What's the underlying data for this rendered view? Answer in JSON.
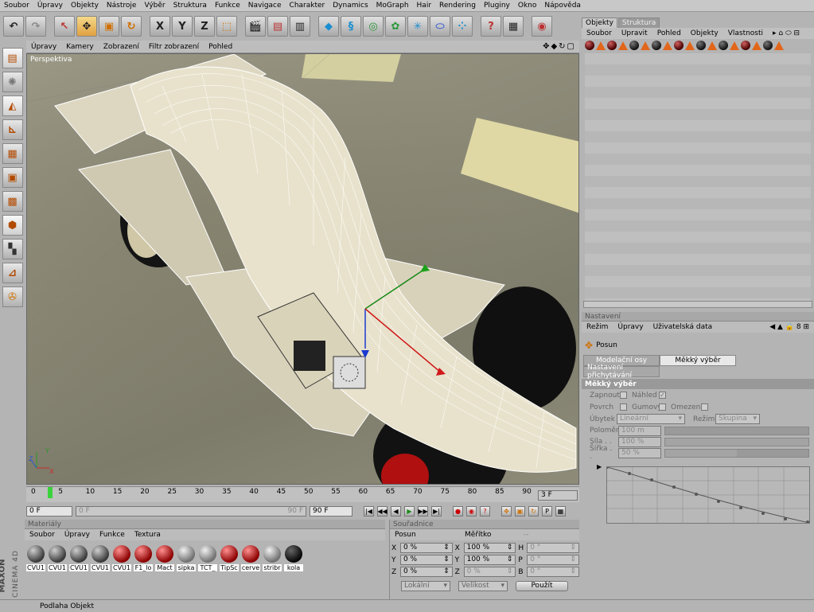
{
  "menubar": [
    "Soubor",
    "Úpravy",
    "Objekty",
    "Nástroje",
    "Výběr",
    "Struktura",
    "Funkce",
    "Navigace",
    "Charakter",
    "Dynamics",
    "MoGraph",
    "Hair",
    "Rendering",
    "Pluginy",
    "Okno",
    "Nápověda"
  ],
  "toolbar": {
    "axis_x": "X",
    "axis_y": "Y",
    "axis_z": "Z"
  },
  "viewport": {
    "menu": [
      "Úpravy",
      "Kamery",
      "Zobrazení",
      "Filtr zobrazení",
      "Pohled"
    ],
    "label": "Perspektiva",
    "axis_x": "X",
    "axis_y": "Y",
    "axis_z": "Z"
  },
  "timeline": {
    "ticks": [
      "0",
      "5",
      "10",
      "15",
      "20",
      "25",
      "30",
      "35",
      "40",
      "45",
      "50",
      "55",
      "60",
      "65",
      "70",
      "75",
      "80",
      "85",
      "90"
    ],
    "end_frame": "3 F"
  },
  "transport": {
    "current_frame": "0 F",
    "start_field": "0 F",
    "mid_field": "90 F",
    "end_field": "90 F"
  },
  "materials": {
    "title": "Materiály",
    "menu": [
      "Soubor",
      "Úpravy",
      "Funkce",
      "Textura"
    ],
    "items": [
      {
        "name": "CVU1",
        "style": "dark"
      },
      {
        "name": "CVU1",
        "style": "dark"
      },
      {
        "name": "CVU1",
        "style": "dark"
      },
      {
        "name": "CVU1",
        "style": "dark"
      },
      {
        "name": "CVU1",
        "style": "red"
      },
      {
        "name": "F1_lo",
        "style": "red"
      },
      {
        "name": "Mact",
        "style": "red"
      },
      {
        "name": "sipka",
        "style": "grey"
      },
      {
        "name": "TCT_",
        "style": "grey"
      },
      {
        "name": "TipSc",
        "style": "red"
      },
      {
        "name": "cerve",
        "style": "red"
      },
      {
        "name": "stribr",
        "style": "grey"
      },
      {
        "name": "kola",
        "style": "black"
      }
    ]
  },
  "coords": {
    "title": "Souřadnice",
    "col1": "Posun",
    "col2": "Měřítko",
    "col3": "--",
    "rows": [
      {
        "a1": "X",
        "v1": "0 %",
        "a2": "X",
        "v2": "100 %",
        "a3": "H",
        "v3": "0 °"
      },
      {
        "a1": "Y",
        "v1": "0 %",
        "a2": "Y",
        "v2": "100 %",
        "a3": "P",
        "v3": "0 °"
      },
      {
        "a1": "Z",
        "v1": "0 %",
        "a2": "Z",
        "v2": "0 %",
        "a3": "B",
        "v3": "0 °"
      }
    ],
    "mode": "Lokální",
    "size": "Velikost",
    "apply": "Použít"
  },
  "objects": {
    "tab_active": "Objekty",
    "tab_inactive": "Struktura",
    "menu": [
      "Soubor",
      "Upravit",
      "Pohled",
      "Objekty",
      "Vlastnosti"
    ]
  },
  "attributes": {
    "title": "Nastavení",
    "menu": [
      "Režim",
      "Úpravy",
      "Uživatelská data"
    ],
    "tool_name": "Posun",
    "seg_model": "Modelační osy",
    "seg_soft": "Měkký výběr",
    "seg_snap": "Nastavení přichytávání",
    "section": "Měkký výběr",
    "zapnout": "Zapnout",
    "nahled": "Náhled",
    "povrch": "Povrch",
    "gumovy": "Gumový",
    "omezeni": "Omezení",
    "ubytek": "Úbytek",
    "ubytek_val": "Lineární",
    "rezim": "Režim",
    "rezim_val": "Skupina",
    "polomer": "Poloměr",
    "polomer_val": "100 m",
    "sila": "Síla . .",
    "sila_val": "100 %",
    "sirka": "Šířka . .",
    "sirka_val": "50 %",
    "sirka_level": 0.5
  },
  "status": "Podlaha Objekt",
  "logo_top": "MAXON",
  "logo_bottom": "CINEMA 4D"
}
